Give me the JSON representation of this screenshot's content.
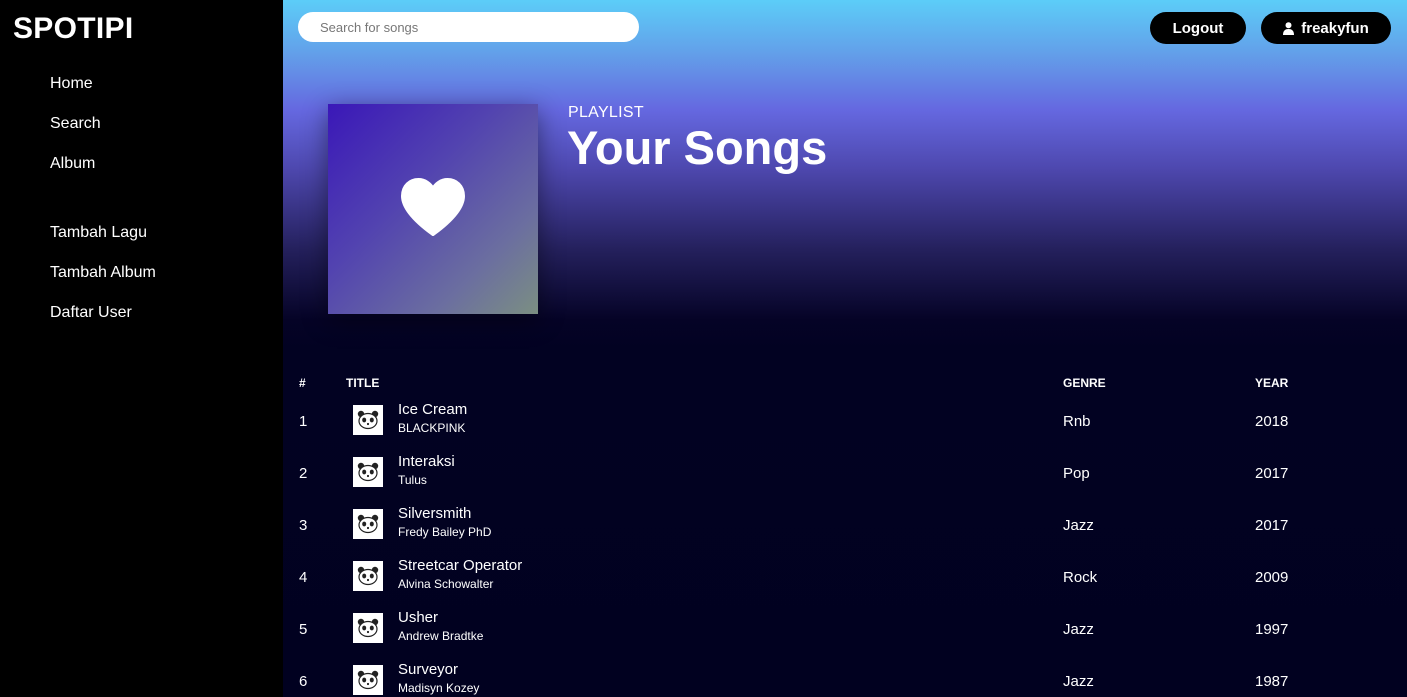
{
  "sidebar": {
    "logo": "SPOTIPI",
    "items": [
      {
        "label": "Home"
      },
      {
        "label": "Search"
      },
      {
        "label": "Album"
      },
      {
        "label": "Tambah Lagu"
      },
      {
        "label": "Tambah Album"
      },
      {
        "label": "Daftar User"
      }
    ]
  },
  "header": {
    "search_placeholder": "Search for songs",
    "logout_label": "Logout",
    "username": "freakyfun"
  },
  "playlist": {
    "label": "PLAYLIST",
    "title": "Your Songs",
    "cover_icon": "heart-icon"
  },
  "table": {
    "columns": {
      "num": "#",
      "title": "TITLE",
      "genre": "GENRE",
      "year": "YEAR"
    },
    "rows": [
      {
        "num": "1",
        "title": "Ice Cream",
        "artist": "BLACKPINK",
        "genre": "Rnb",
        "year": "2018"
      },
      {
        "num": "2",
        "title": "Interaksi",
        "artist": "Tulus",
        "genre": "Pop",
        "year": "2017"
      },
      {
        "num": "3",
        "title": "Silversmith",
        "artist": "Fredy Bailey PhD",
        "genre": "Jazz",
        "year": "2017"
      },
      {
        "num": "4",
        "title": "Streetcar Operator",
        "artist": "Alvina Schowalter",
        "genre": "Rock",
        "year": "2009"
      },
      {
        "num": "5",
        "title": "Usher",
        "artist": "Andrew Bradtke",
        "genre": "Jazz",
        "year": "1997"
      },
      {
        "num": "6",
        "title": "Surveyor",
        "artist": "Madisyn Kozey",
        "genre": "Jazz",
        "year": "1987"
      }
    ]
  },
  "colors": {
    "sidebar_bg": "#000000",
    "gradient_top": "#5ccdf8",
    "gradient_mid": "#6568e0",
    "gradient_bottom": "#010120"
  }
}
